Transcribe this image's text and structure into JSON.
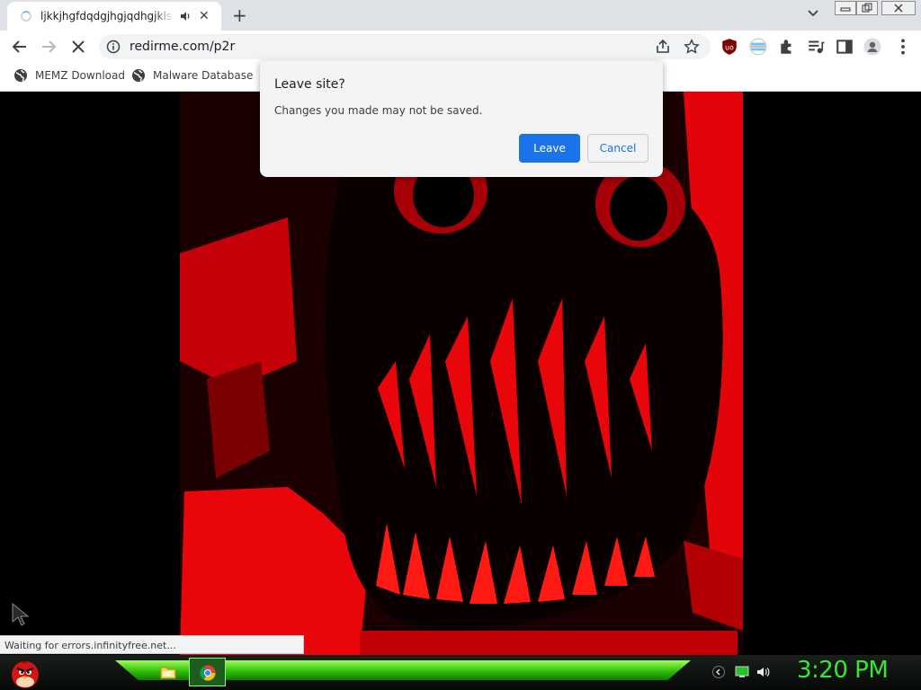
{
  "tab": {
    "title": "ljkkjhgfdqdgjhgjqdhgjklstrhqjk",
    "close": "✕"
  },
  "new_tab_label": "+",
  "window": {
    "minimize": "▭",
    "restore": "⧉",
    "close": "✕"
  },
  "toolbar": {
    "url": "redirme.com/p2r"
  },
  "bookmarks": [
    {
      "label": "MEMZ Download",
      "icon": "globe-icon"
    },
    {
      "label": "Malware Database",
      "icon": "globe-icon"
    }
  ],
  "dialog": {
    "title": "Leave site?",
    "message": "Changes you made may not be saved.",
    "leave_label": "Leave",
    "cancel_label": "Cancel"
  },
  "status_text": "Waiting for errors.infinityfree.net...",
  "taskbar": {
    "clock": "3:20 PM"
  },
  "colors": {
    "accent": "#1a73e8",
    "clock": "#38e634",
    "content_red": "#e8060a"
  }
}
